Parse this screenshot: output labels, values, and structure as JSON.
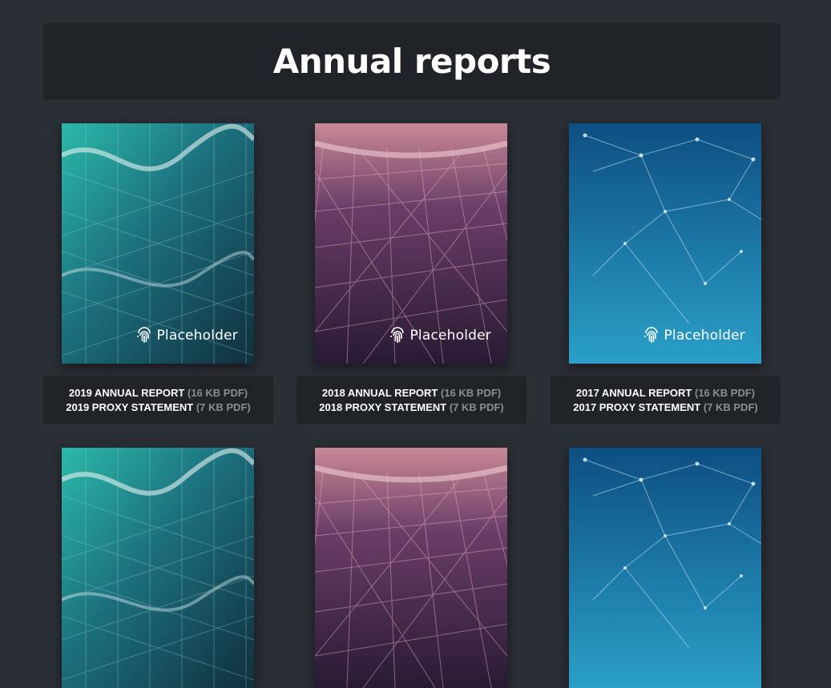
{
  "page": {
    "title": "Annual reports"
  },
  "reports": [
    {
      "cover_brand": "Placeholder",
      "cover_theme": "teal",
      "report_label": "2019 ANNUAL REPORT",
      "report_meta": "(16 KB PDF)",
      "proxy_label": "2019 PROXY STATEMENT",
      "proxy_meta": "(7 KB PDF)"
    },
    {
      "cover_brand": "Placeholder",
      "cover_theme": "purple",
      "report_label": "2018 ANNUAL REPORT",
      "report_meta": "(16 KB PDF)",
      "proxy_label": "2018 PROXY STATEMENT",
      "proxy_meta": "(7 KB PDF)"
    },
    {
      "cover_brand": "Placeholder",
      "cover_theme": "blue",
      "report_label": "2017 ANNUAL REPORT",
      "report_meta": "(16 KB PDF)",
      "proxy_label": "2017 PROXY STATEMENT",
      "proxy_meta": "(7 KB PDF)"
    },
    {
      "cover_theme": "teal"
    },
    {
      "cover_theme": "purple"
    },
    {
      "cover_theme": "blue"
    }
  ],
  "colors": {
    "background": "#2a2e35",
    "panel": "#202327",
    "meta_text": "#8a8d92"
  }
}
